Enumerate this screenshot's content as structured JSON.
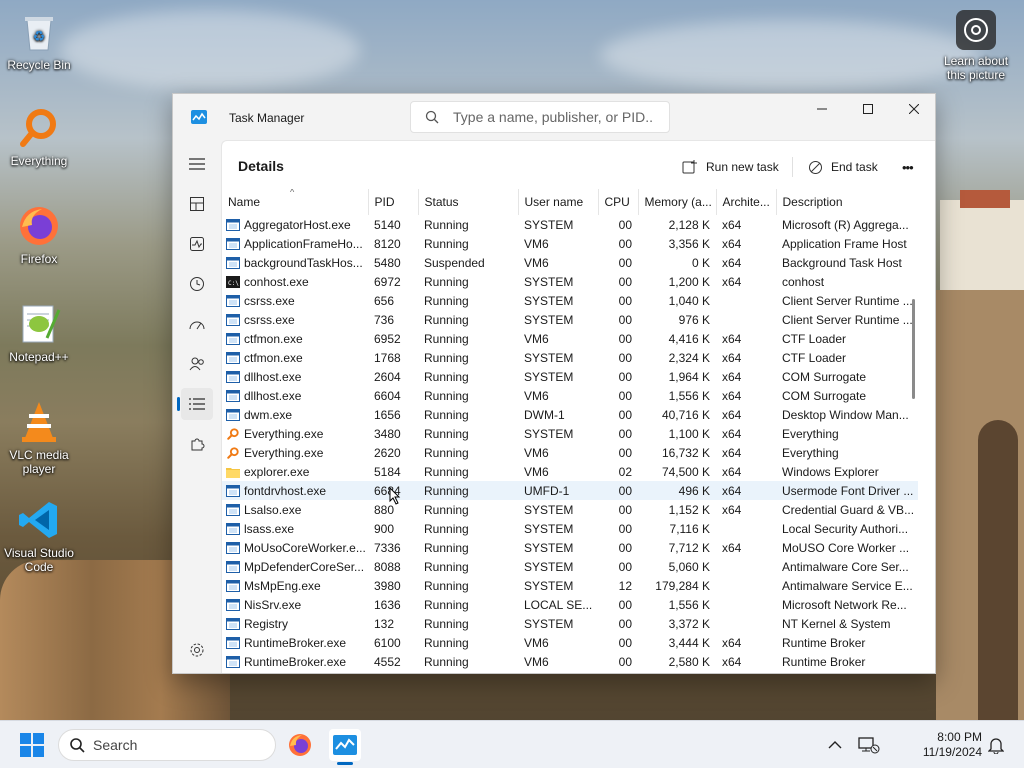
{
  "desktop": {
    "icons": [
      {
        "label": "Recycle Bin"
      },
      {
        "label": "Everything"
      },
      {
        "label": "Firefox"
      },
      {
        "label": "Notepad++"
      },
      {
        "label": "VLC media player"
      },
      {
        "label": "Visual Studio Code"
      }
    ],
    "learn_label": "Learn about this picture"
  },
  "window": {
    "title": "Task Manager",
    "search_placeholder": "Type a name, publisher, or PID..."
  },
  "page": {
    "title": "Details",
    "run_new_task": "Run new task",
    "end_task": "End task",
    "more": "•••"
  },
  "table": {
    "columns": [
      "Name",
      "PID",
      "Status",
      "User name",
      "CPU",
      "Memory (a...",
      "Archite...",
      "Description"
    ],
    "rows": [
      {
        "name": "AggregatorHost.exe",
        "pid": "5140",
        "status": "Running",
        "user": "SYSTEM",
        "cpu": "00",
        "mem": "2,128 K",
        "arch": "x64",
        "desc": "Microsoft (R) Aggrega...",
        "icon": "app"
      },
      {
        "name": "ApplicationFrameHo...",
        "pid": "8120",
        "status": "Running",
        "user": "VM6",
        "cpu": "00",
        "mem": "3,356 K",
        "arch": "x64",
        "desc": "Application Frame Host",
        "icon": "app"
      },
      {
        "name": "backgroundTaskHos...",
        "pid": "5480",
        "status": "Suspended",
        "user": "VM6",
        "cpu": "00",
        "mem": "0 K",
        "arch": "x64",
        "desc": "Background Task Host",
        "icon": "app"
      },
      {
        "name": "conhost.exe",
        "pid": "6972",
        "status": "Running",
        "user": "SYSTEM",
        "cpu": "00",
        "mem": "1,200 K",
        "arch": "x64",
        "desc": "conhost",
        "icon": "console"
      },
      {
        "name": "csrss.exe",
        "pid": "656",
        "status": "Running",
        "user": "SYSTEM",
        "cpu": "00",
        "mem": "1,040 K",
        "arch": "",
        "desc": "Client Server Runtime ...",
        "icon": "app"
      },
      {
        "name": "csrss.exe",
        "pid": "736",
        "status": "Running",
        "user": "SYSTEM",
        "cpu": "00",
        "mem": "976 K",
        "arch": "",
        "desc": "Client Server Runtime ...",
        "icon": "app"
      },
      {
        "name": "ctfmon.exe",
        "pid": "6952",
        "status": "Running",
        "user": "VM6",
        "cpu": "00",
        "mem": "4,416 K",
        "arch": "x64",
        "desc": "CTF Loader",
        "icon": "app"
      },
      {
        "name": "ctfmon.exe",
        "pid": "1768",
        "status": "Running",
        "user": "SYSTEM",
        "cpu": "00",
        "mem": "2,324 K",
        "arch": "x64",
        "desc": "CTF Loader",
        "icon": "app"
      },
      {
        "name": "dllhost.exe",
        "pid": "2604",
        "status": "Running",
        "user": "SYSTEM",
        "cpu": "00",
        "mem": "1,964 K",
        "arch": "x64",
        "desc": "COM Surrogate",
        "icon": "app"
      },
      {
        "name": "dllhost.exe",
        "pid": "6604",
        "status": "Running",
        "user": "VM6",
        "cpu": "00",
        "mem": "1,556 K",
        "arch": "x64",
        "desc": "COM Surrogate",
        "icon": "app"
      },
      {
        "name": "dwm.exe",
        "pid": "1656",
        "status": "Running",
        "user": "DWM-1",
        "cpu": "00",
        "mem": "40,716 K",
        "arch": "x64",
        "desc": "Desktop Window Man...",
        "icon": "app"
      },
      {
        "name": "Everything.exe",
        "pid": "3480",
        "status": "Running",
        "user": "SYSTEM",
        "cpu": "00",
        "mem": "1,100 K",
        "arch": "x64",
        "desc": "Everything",
        "icon": "everything"
      },
      {
        "name": "Everything.exe",
        "pid": "2620",
        "status": "Running",
        "user": "VM6",
        "cpu": "00",
        "mem": "16,732 K",
        "arch": "x64",
        "desc": "Everything",
        "icon": "everything"
      },
      {
        "name": "explorer.exe",
        "pid": "5184",
        "status": "Running",
        "user": "VM6",
        "cpu": "02",
        "mem": "74,500 K",
        "arch": "x64",
        "desc": "Windows Explorer",
        "icon": "folder"
      },
      {
        "name": "fontdrvhost.exe",
        "pid": "6684",
        "status": "Running",
        "user": "UMFD-1",
        "cpu": "00",
        "mem": "496 K",
        "arch": "x64",
        "desc": "Usermode Font Driver ...",
        "icon": "app",
        "selected": true
      },
      {
        "name": "Lsalso.exe",
        "pid": "880",
        "status": "Running",
        "user": "SYSTEM",
        "cpu": "00",
        "mem": "1,152 K",
        "arch": "x64",
        "desc": "Credential Guard & VB...",
        "icon": "app"
      },
      {
        "name": "lsass.exe",
        "pid": "900",
        "status": "Running",
        "user": "SYSTEM",
        "cpu": "00",
        "mem": "7,116 K",
        "arch": "",
        "desc": "Local Security Authori...",
        "icon": "app"
      },
      {
        "name": "MoUsoCoreWorker.e...",
        "pid": "7336",
        "status": "Running",
        "user": "SYSTEM",
        "cpu": "00",
        "mem": "7,712 K",
        "arch": "x64",
        "desc": "MoUSO Core Worker ...",
        "icon": "app"
      },
      {
        "name": "MpDefenderCoreSer...",
        "pid": "8088",
        "status": "Running",
        "user": "SYSTEM",
        "cpu": "00",
        "mem": "5,060 K",
        "arch": "",
        "desc": "Antimalware Core Ser...",
        "icon": "app"
      },
      {
        "name": "MsMpEng.exe",
        "pid": "3980",
        "status": "Running",
        "user": "SYSTEM",
        "cpu": "12",
        "mem": "179,284 K",
        "arch": "",
        "desc": "Antimalware Service E...",
        "icon": "app"
      },
      {
        "name": "NisSrv.exe",
        "pid": "1636",
        "status": "Running",
        "user": "LOCAL SE...",
        "cpu": "00",
        "mem": "1,556 K",
        "arch": "",
        "desc": "Microsoft Network Re...",
        "icon": "app"
      },
      {
        "name": "Registry",
        "pid": "132",
        "status": "Running",
        "user": "SYSTEM",
        "cpu": "00",
        "mem": "3,372 K",
        "arch": "",
        "desc": "NT Kernel & System",
        "icon": "app"
      },
      {
        "name": "RuntimeBroker.exe",
        "pid": "6100",
        "status": "Running",
        "user": "VM6",
        "cpu": "00",
        "mem": "3,444 K",
        "arch": "x64",
        "desc": "Runtime Broker",
        "icon": "app"
      },
      {
        "name": "RuntimeBroker.exe",
        "pid": "4552",
        "status": "Running",
        "user": "VM6",
        "cpu": "00",
        "mem": "2,580 K",
        "arch": "x64",
        "desc": "Runtime Broker",
        "icon": "app"
      }
    ]
  },
  "taskbar": {
    "search_label": "Search",
    "time": "8:00 PM",
    "date": "11/19/2024"
  },
  "colors": {
    "accent": "#0067c0",
    "selected_row": "#eaf3fb"
  }
}
